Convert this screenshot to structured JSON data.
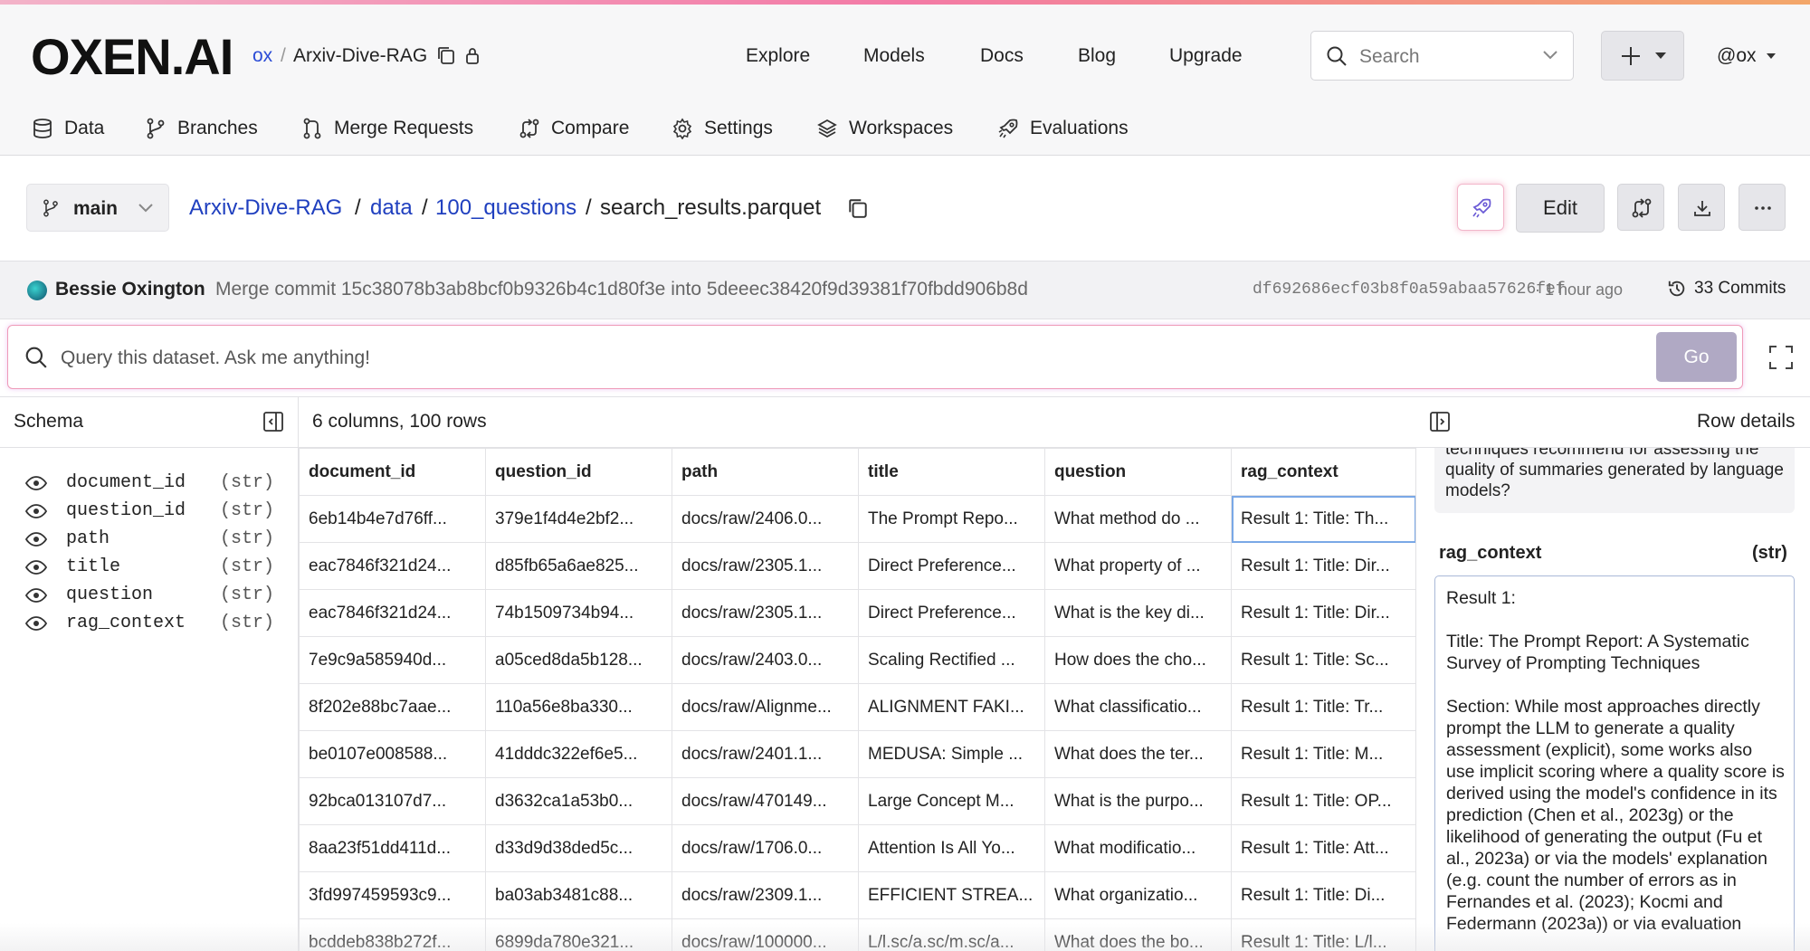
{
  "app": {
    "logo": "OXEN.AI"
  },
  "repo": {
    "owner": "ox",
    "separator": "/",
    "name": "Arxiv-Dive-RAG"
  },
  "nav": {
    "explore": "Explore",
    "models": "Models",
    "docs": "Docs",
    "blog": "Blog",
    "upgrade": "Upgrade"
  },
  "search": {
    "placeholder": "Search"
  },
  "user": {
    "handle": "@ox"
  },
  "tabs": [
    {
      "label": "Data",
      "icon": "database-icon"
    },
    {
      "label": "Branches",
      "icon": "branch-icon"
    },
    {
      "label": "Merge Requests",
      "icon": "merge-icon"
    },
    {
      "label": "Compare",
      "icon": "compare-icon"
    },
    {
      "label": "Settings",
      "icon": "gear-icon"
    },
    {
      "label": "Workspaces",
      "icon": "layers-icon"
    },
    {
      "label": "Evaluations",
      "icon": "rocket-icon"
    }
  ],
  "file_bar": {
    "branch": "main",
    "path": [
      "Arxiv-Dive-RAG",
      "data",
      "100_questions",
      "search_results.parquet"
    ],
    "sep": "/",
    "edit_label": "Edit"
  },
  "commit": {
    "author": "Bessie Oxington",
    "message": "Merge commit 15c38078b3ab8bcf0b9326b4c1d80f3e into 5deeec38420f9d39381f70fbdd906b8d",
    "hash": "df692686ecf03b8f0a59abaa57626fef",
    "time": "· 1 hour ago",
    "commits_label": "33 Commits"
  },
  "query": {
    "placeholder": "Query this dataset. Ask me anything!",
    "go_label": "Go"
  },
  "schema": {
    "title": "Schema",
    "fields": [
      {
        "name": "document_id",
        "type": "(str)"
      },
      {
        "name": "question_id",
        "type": "(str)"
      },
      {
        "name": "path",
        "type": "(str)"
      },
      {
        "name": "title",
        "type": "(str)"
      },
      {
        "name": "question",
        "type": "(str)"
      },
      {
        "name": "rag_context",
        "type": "(str)"
      }
    ]
  },
  "table": {
    "meta": "6 columns, 100 rows",
    "columns": [
      "document_id",
      "question_id",
      "path",
      "title",
      "question",
      "rag_context"
    ],
    "rows": [
      [
        "6eb14b4e7d76ff...",
        "379e1f4d4e2bf2...",
        "docs/raw/2406.0...",
        "The Prompt Repo...",
        "What method do ...",
        "Result 1: Title: Th..."
      ],
      [
        "eac7846f321d24...",
        "d85fb65a6ae825...",
        "docs/raw/2305.1...",
        "Direct Preference...",
        "What property of ...",
        "Result 1: Title: Dir..."
      ],
      [
        "eac7846f321d24...",
        "74b1509734b94...",
        "docs/raw/2305.1...",
        "Direct Preference...",
        "What is the key di...",
        "Result 1: Title: Dir..."
      ],
      [
        "7e9c9a585940d...",
        "a05ced8da5b128...",
        "docs/raw/2403.0...",
        "Scaling Rectified ...",
        "How does the cho...",
        "Result 1: Title: Sc..."
      ],
      [
        "8f202e88bc7aae...",
        "110a56e8ba330...",
        "docs/raw/Alignme...",
        "ALIGNMENT FAKI...",
        "What classificatio...",
        "Result 1: Title: Tr..."
      ],
      [
        "be0107e008588...",
        "41dddc322ef6e5...",
        "docs/raw/2401.1...",
        "MEDUSA: Simple ...",
        "What does the ter...",
        "Result 1: Title: M..."
      ],
      [
        "92bca013107d7...",
        "d3632ca1a53b0...",
        "docs/raw/470149...",
        "Large Concept M...",
        "What is the purpo...",
        "Result 1: Title: OP..."
      ],
      [
        "8aa23f51dd411d...",
        "d33d9d38ded5c...",
        "docs/raw/1706.0...",
        "Attention Is All Yo...",
        "What modificatio...",
        "Result 1: Title: Att..."
      ],
      [
        "3fd997459593c9...",
        "ba03ab3481c88...",
        "docs/raw/2309.1...",
        "EFFICIENT STREA...",
        "What organizatio...",
        "Result 1: Title: Di..."
      ],
      [
        "bcddeb838b272f...",
        "6899da780e321...",
        "docs/raw/100000...",
        "L/l.sc/a.sc/m.sc/a...",
        "What does the bo...",
        "Result 1: Title: L/l..."
      ]
    ]
  },
  "details": {
    "title": "Row details",
    "prev_field_text": "techniques recommend for assessing the quality of summaries generated by language models?",
    "field_name": "rag_context",
    "field_type": "(str)",
    "field_value": "Result 1:\n\nTitle: The Prompt Report: A Systematic Survey of Prompting Techniques\n\nSection: While most approaches directly prompt the LLM to generate a quality assessment (explicit), some works also use implicit scoring where a quality score is derived using the model's confidence in its prediction (Chen et al., 2023g) or the likelihood of generating the output (Fu et al., 2023a) or via the models' explanation (e.g. count the number of errors as in Fernandes et al. (2023); Kocmi and Federmann (2023a)) or via evaluation"
  },
  "colors": {
    "link": "#1f3fbf",
    "accent": "#2a4bd6",
    "go_button": "#b0a9c4"
  }
}
